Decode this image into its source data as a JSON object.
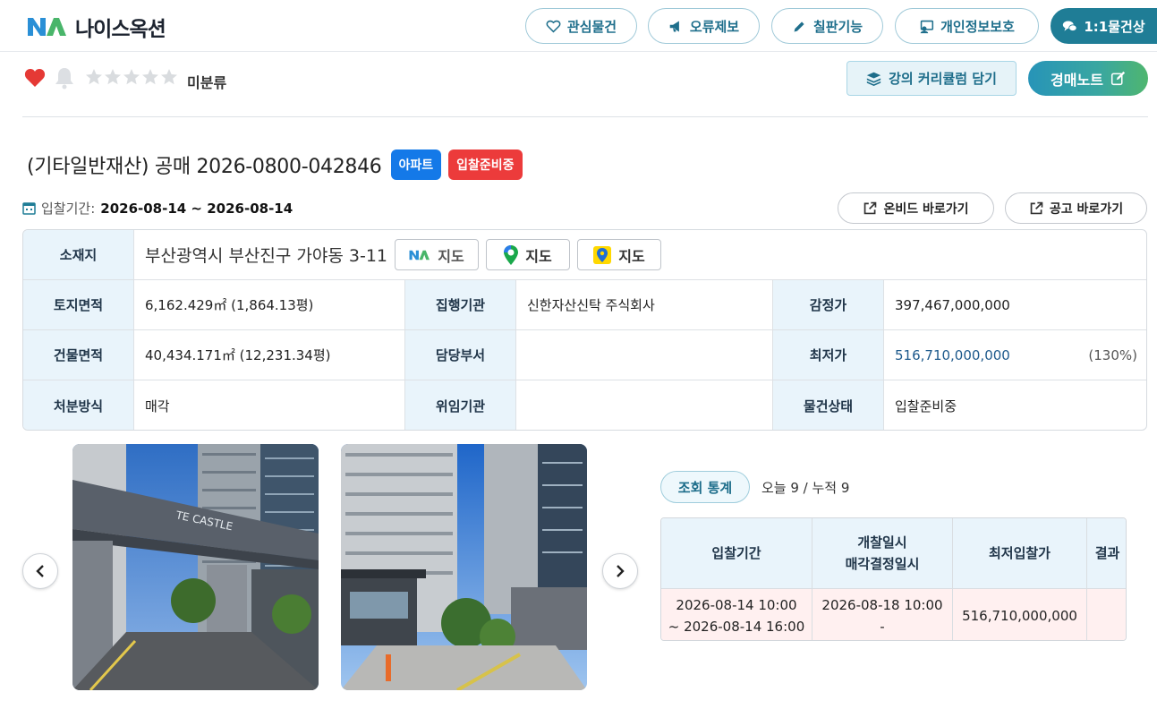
{
  "header": {
    "brand": "나이스옥션",
    "buttons": {
      "favorites": "관심물건",
      "report_error": "오류제보",
      "blackboard": "칠판기능",
      "privacy": "개인정보보호",
      "consult": "1:1물건상"
    }
  },
  "toolbar": {
    "category": "미분류",
    "rating_stars": 5,
    "rating_value": 0,
    "favorite": true,
    "curriculum_button": "강의 커리큘럼 담기",
    "note_button": "경매노트"
  },
  "item": {
    "title": "(기타일반재산) 공매 2026-0800-042846",
    "type_badge": "아파트",
    "status_badge": "입찰준비중",
    "period_label": "입찰기간:",
    "period_value": "2026-08-14 ~ 2026-08-14",
    "onbid_link": "온비드 바로가기",
    "notice_link": "공고 바로가기"
  },
  "info_table": {
    "location_label": "소재지",
    "location_value": "부산광역시 부산진구 가야동 3-11",
    "map_buttons": [
      "지도",
      "지도",
      "지도"
    ],
    "land_area_label": "토지면적",
    "land_area_value": "6,162.429㎡ (1,864.13평)",
    "executor_label": "집행기관",
    "executor_value": "신한자산신탁 주식회사",
    "appraisal_label": "감정가",
    "appraisal_value": "397,467,000,000",
    "building_area_label": "건물면적",
    "building_area_value": "40,434.171㎡ (12,231.34평)",
    "department_label": "담당부서",
    "department_value": "",
    "min_price_label": "최저가",
    "min_price_value": "516,710,000,000",
    "min_price_ratio": "(130%)",
    "disposal_label": "처분방식",
    "disposal_value": "매각",
    "delegate_label": "위임기관",
    "delegate_value": "",
    "status_label": "물건상태",
    "status_value": "입찰준비중"
  },
  "photos": {
    "sign_text": "TE CASTLE"
  },
  "stats": {
    "label": "조회 통계",
    "text": "오늘 9 / 누적 9"
  },
  "bid_table": {
    "headers": [
      "입찰기간",
      "개찰일시",
      "매각결정일시",
      "최저입찰가",
      "결과"
    ],
    "row": {
      "period_start": "2026-08-14 10:00",
      "period_end": "~ 2026-08-14 16:00",
      "open_datetime": "2026-08-18 10:00",
      "decision_datetime": "-",
      "min_bid": "516,710,000,000",
      "result": ""
    }
  },
  "colors": {
    "accent": "#1f7d96",
    "header_cell": "#e9f4fb",
    "badge_blue": "#1479e8",
    "badge_red": "#ec3b3b",
    "min_price": "#1e5a8c"
  }
}
